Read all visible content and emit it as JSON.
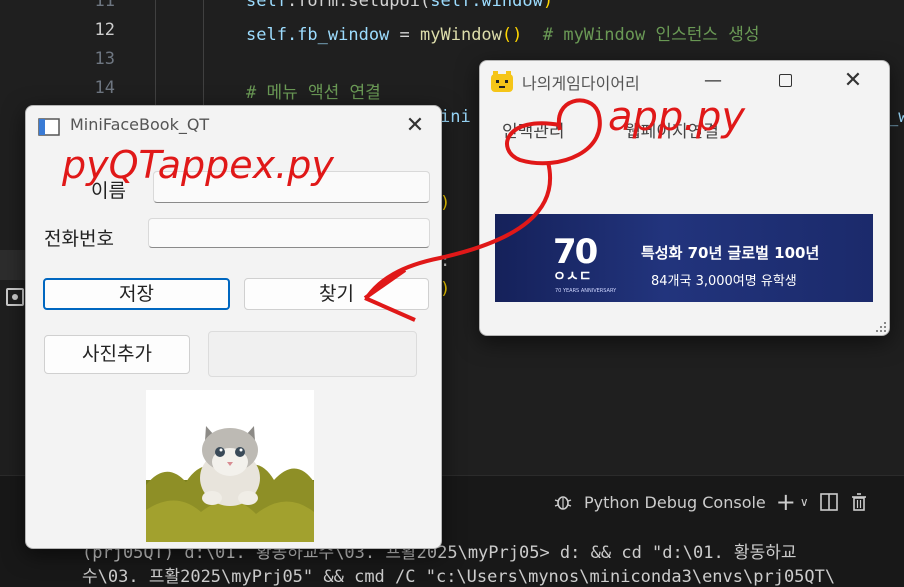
{
  "editor": {
    "line_numbers": [
      "11",
      "12",
      "13",
      "14"
    ],
    "code": {
      "line11": {
        "obj": "self",
        "rest": ".form.setupUi(",
        "arg": "self.window",
        "close": ")"
      },
      "line12": {
        "lhs": "self.fb_window",
        "eq": " = ",
        "fn": "myWindow",
        "parens": "()",
        "comment": "  # myWindow 인스턴스 생성"
      },
      "line14": {
        "comment": "# 메뉴 액션 연결"
      },
      "partial_mid": "ini",
      "partial_right": "_w",
      "paren_a": ")",
      "paren_b": ":",
      "paren_c": ")"
    }
  },
  "terminal": {
    "toolbar": {
      "debug_label": "Python Debug Console",
      "plus": "+",
      "chevron": "∨"
    },
    "lines": [
      "(prj05QT) d:\\01. 황동하교수\\03. 프활2025\\myPrj05> d: && cd \"d:\\01. 황동하교",
      "수\\03. 프활2025\\myPrj05\" && cmd /C \"c:\\Users\\mynos\\miniconda3\\envs\\prj05QT\\"
    ]
  },
  "minifacebook": {
    "title": "MiniFaceBook_QT",
    "name_label": "이름",
    "phone_label": "전화번호",
    "name_value": "",
    "phone_value": "",
    "save_button": "저장",
    "find_button": "찾기",
    "add_photo_button": "사진추가",
    "photo_path_button": ""
  },
  "main_window": {
    "title": "나의게임다이어리",
    "tabs": [
      "인맥관리",
      "웹페이지연결"
    ],
    "banner": {
      "big_number": "70",
      "sub_logo": "ㅇㅅㄷ",
      "anniv": "70 YEARS ANNIVERSARY",
      "line1": "특성화 70년 글로벌 100년",
      "line2": "84개국 3,000여명 유학생"
    }
  },
  "annotations": {
    "left_label": "pyQTappex.py",
    "right_label": "app.py"
  },
  "colors": {
    "editor_bg": "#1f1f1f",
    "banner_bg": "#1b2a6b",
    "annotation_red": "#e01818",
    "focus_blue": "#0067c0"
  }
}
